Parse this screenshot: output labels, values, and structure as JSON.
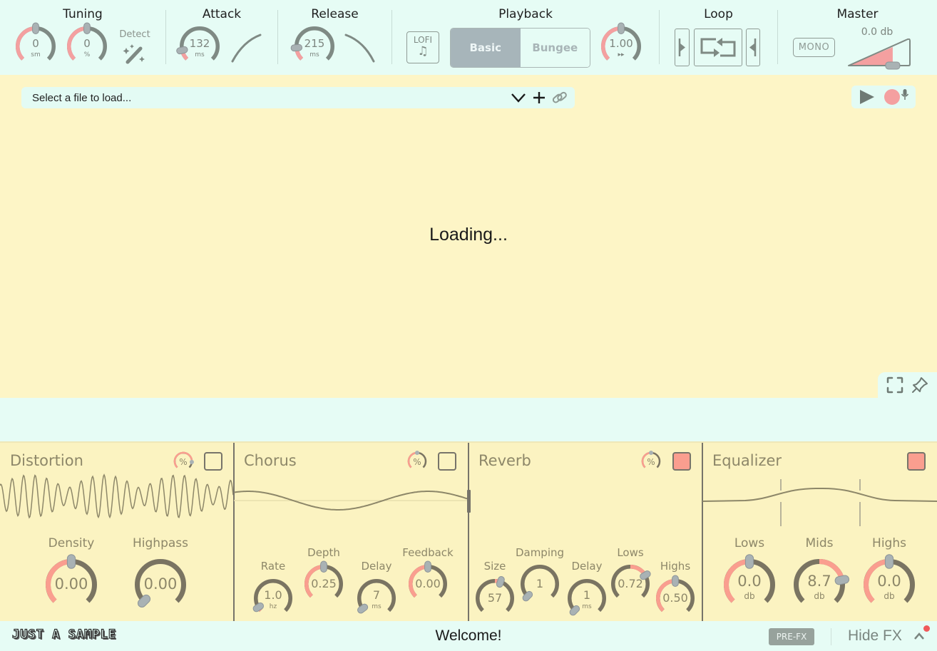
{
  "toolbar": {
    "tuning": {
      "title": "Tuning",
      "semitones": {
        "value": "0",
        "unit": "sm",
        "fraction": 0.5
      },
      "cents": {
        "value": "0",
        "unit": "%",
        "fraction": 0.5
      },
      "detect_label": "Detect"
    },
    "attack": {
      "title": "Attack",
      "value": "132",
      "unit": "ms",
      "fraction": 0.12
    },
    "release": {
      "title": "Release",
      "value": "215",
      "unit": "ms",
      "fraction": 0.15
    },
    "playback": {
      "title": "Playback",
      "lofi_label": "LOFI",
      "lofi_icon": "♫",
      "modes": [
        {
          "label": "Basic",
          "active": true
        },
        {
          "label": "Bungee",
          "active": false
        }
      ],
      "speed": {
        "value": "1.00",
        "unit": "▸▸",
        "fraction": 0.5
      }
    },
    "loop": {
      "title": "Loop"
    },
    "master": {
      "title": "Master",
      "mono_label": "MONO",
      "gain_label": "0.0 db",
      "gain_fraction": 0.72
    }
  },
  "waveform": {
    "file_placeholder": "Select a file to load...",
    "loading_text": "Loading..."
  },
  "fx": {
    "distortion": {
      "title": "Distortion",
      "enabled": false,
      "mix_fraction": 0.85,
      "knobs": [
        {
          "label": "Density",
          "value": "0.00",
          "unit": "",
          "fraction": 0.5
        },
        {
          "label": "Highpass",
          "value": "0.00",
          "unit": "",
          "fraction": 0.0
        }
      ]
    },
    "chorus": {
      "title": "Chorus",
      "enabled": false,
      "mix_fraction": 0.5,
      "knobs": [
        {
          "label": "Rate",
          "value": "1.0",
          "unit": "hz",
          "fraction": 0.05
        },
        {
          "label": "Depth",
          "value": "0.25",
          "unit": "",
          "fraction": 0.5
        },
        {
          "label": "Delay",
          "value": "7",
          "unit": "ms",
          "fraction": 0.03
        },
        {
          "label": "Feedback",
          "value": "0.00",
          "unit": "",
          "fraction": 0.5
        }
      ]
    },
    "reverb": {
      "title": "Reverb",
      "enabled": true,
      "mix_fraction": 0.5,
      "knobs": [
        {
          "label": "Size",
          "value": "57",
          "unit": "",
          "fraction": 0.57
        },
        {
          "label": "Damping",
          "value": "1",
          "unit": "",
          "fraction": 0.0
        },
        {
          "label": "Delay",
          "value": "1",
          "unit": "ms",
          "fraction": 0.0
        },
        {
          "label": "Lows",
          "value": "0.72",
          "unit": "",
          "fraction": 0.72
        },
        {
          "label": "Highs",
          "value": "0.50",
          "unit": "",
          "fraction": 0.5
        }
      ]
    },
    "equalizer": {
      "title": "Equalizer",
      "enabled": true,
      "knobs": [
        {
          "label": "Lows",
          "value": "0.0",
          "unit": "db",
          "fraction": 0.5
        },
        {
          "label": "Mids",
          "value": "8.7",
          "unit": "db",
          "fraction": 0.79
        },
        {
          "label": "Highs",
          "value": "0.0",
          "unit": "db",
          "fraction": 0.5
        }
      ]
    }
  },
  "status": {
    "brand": "JUST A SAMPLE",
    "message": "Welcome!",
    "prefx_label": "PRE-FX",
    "hidefx_label": "Hide FX"
  },
  "colors": {
    "accent": "#f4a0a0",
    "fx_accent": "#fa9e8f",
    "track_top": "#7f8a84",
    "track_fx": "#7a7462",
    "handle": "#a9b2b4",
    "toolbar_bg": "#e6fcf5",
    "wave_bg": "#fdf5c6",
    "fx_bg": "#fbf3c1"
  }
}
